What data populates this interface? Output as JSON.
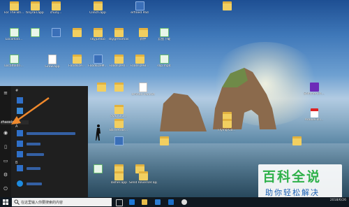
{
  "desktop": {
    "icons": [
      {
        "label": "For The Bri...",
        "type": "folder",
        "icon": "folder-icon"
      },
      {
        "label": "tinyrail.app",
        "type": "folder",
        "icon": "folder-icon"
      },
      {
        "label": "chunj...",
        "type": "folder",
        "icon": "folder-icon"
      },
      {
        "label": "Clinch.app",
        "type": "folder",
        "icon": "folder-icon"
      },
      {
        "label": "erfined Pad",
        "type": "app",
        "icon": "app-icon"
      },
      {
        "label": "",
        "type": "folder",
        "icon": "folder-icon"
      },
      {
        "label": "Localfold...",
        "type": "mp4",
        "icon": "mp4-icon"
      },
      {
        "label": "",
        "type": "mp4",
        "icon": "mp4-icon"
      },
      {
        "label": "",
        "type": "app",
        "icon": "app-icon"
      },
      {
        "label": "",
        "type": "folder",
        "icon": "folder-icon"
      },
      {
        "label": "skyjumbo",
        "type": "folder",
        "icon": "folder-icon"
      },
      {
        "label": "新件",
        "type": "folder",
        "icon": "folder-icon"
      },
      {
        "label": "skygrmomas",
        "type": "folder",
        "icon": "folder-icon"
      },
      {
        "label": "云盘下载",
        "type": "mp4",
        "icon": "mp4-icon"
      },
      {
        "label": "Localfoldri...",
        "type": "mp4",
        "icon": "mp4-icon"
      },
      {
        "label": "Grow.app",
        "type": "doc",
        "icon": "doc-icon"
      },
      {
        "label": "Foodsize...",
        "type": "folder",
        "icon": "folder-icon"
      },
      {
        "label": "FoodsizeM...",
        "type": "app",
        "icon": "app-icon"
      },
      {
        "label": "FoodsizeU...",
        "type": "folder",
        "icon": "folder-icon"
      },
      {
        "label": "FoodsizeB...",
        "type": "folder",
        "icon": "folder-icon"
      },
      {
        "label": "slip.mp4",
        "type": "mp4",
        "icon": "mp4-icon"
      },
      {
        "label": "",
        "type": "folder",
        "icon": "folder-icon"
      },
      {
        "label": "",
        "type": "folder",
        "icon": "folder-icon"
      },
      {
        "label": "cVay 3.1...",
        "type": "folder",
        "icon": "folder-icon"
      },
      {
        "label": "erfined Pad.txt",
        "type": "doc",
        "icon": "doc-icon"
      },
      {
        "label": "Barnetdar...",
        "type": "folder",
        "icon": "folder-icon"
      },
      {
        "label": "",
        "type": "folder",
        "icon": "folder-icon"
      },
      {
        "label": "Flying Ga...",
        "type": "folder",
        "icon": "folder-icon"
      },
      {
        "label": "SnitcherSin...",
        "type": "appv",
        "icon": "app-icon"
      },
      {
        "label": "AdobeFull...",
        "type": "pdf",
        "icon": "pdf-icon"
      },
      {
        "label": "",
        "type": "app",
        "icon": "app-icon"
      },
      {
        "label": "",
        "type": "folder",
        "icon": "folder-icon"
      },
      {
        "label": "",
        "type": "folder",
        "icon": "folder-icon"
      },
      {
        "label": "",
        "type": "mp4",
        "icon": "mp4-icon"
      },
      {
        "label": "",
        "type": "folder",
        "icon": "folder-icon"
      },
      {
        "label": "",
        "type": "folder",
        "icon": "folder-icon"
      },
      {
        "label": "Tasher.app",
        "type": "folder",
        "icon": "folder-icon"
      },
      {
        "label": "Send Reverser.app",
        "type": "folder",
        "icon": "folder-icon"
      }
    ]
  },
  "start_menu": {
    "user": "zhaoxiaxg",
    "letters": [
      "#",
      "A",
      "B",
      "C"
    ],
    "items": [
      {
        "label": "",
        "icon": "app-tile-icon"
      },
      {
        "label": "",
        "icon": "app-tile-icon"
      },
      {
        "label": "",
        "icon": "app-tile-icon"
      },
      {
        "label": "",
        "icon": "app-tile-icon"
      },
      {
        "label": "",
        "icon": "app-tile-icon"
      },
      {
        "label": "",
        "icon": "app-tile-icon"
      },
      {
        "label": "",
        "icon": "app-tile-icon"
      },
      {
        "label": "",
        "icon": "app-tile-icon"
      }
    ]
  },
  "taskbar": {
    "search_placeholder": "在这里输入你要搜索的内容",
    "time": "2018/6/26"
  },
  "watermark": {
    "title": "百科全说",
    "subtitle": "助你轻松解决"
  }
}
